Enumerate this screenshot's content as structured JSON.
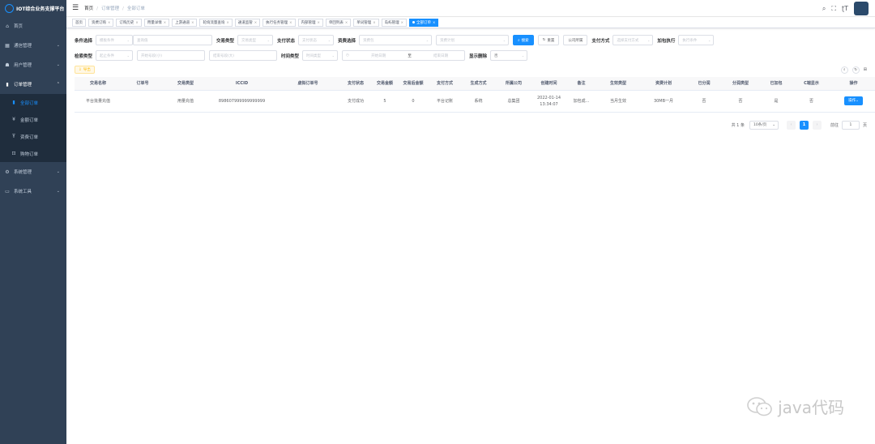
{
  "app": {
    "title": "IOT综合业务支撑平台"
  },
  "sidebar": {
    "items": [
      {
        "label": "首页",
        "icon": "home-icon"
      },
      {
        "label": "通信管理",
        "icon": "grid-icon"
      },
      {
        "label": "用户管理",
        "icon": "user-icon"
      },
      {
        "label": "订单管理",
        "icon": "chart-icon"
      },
      {
        "label": "系统管理",
        "icon": "gear-icon"
      },
      {
        "label": "系统工具",
        "icon": "tool-icon"
      }
    ],
    "order_sub": [
      {
        "label": "全部订单",
        "icon": "bar-icon"
      },
      {
        "label": "金额订单",
        "icon": "yen-icon"
      },
      {
        "label": "资费订单",
        "icon": "tariff-icon"
      },
      {
        "label": "购物订单",
        "icon": "cart-icon"
      }
    ]
  },
  "breadcrumb": {
    "home": "首页",
    "parent": "订单管理",
    "current": "全部订单"
  },
  "tags": [
    "首页",
    "资费订购",
    "订购历史",
    "用量详情",
    "上游通道",
    "轮询流量查询",
    "通道监管",
    "执行任务管理",
    "内部管理",
    "单回列表",
    "单词管理",
    "岛屿管理",
    "全部订单"
  ],
  "filters": {
    "row1": {
      "cond_label": "条件选择",
      "cond_select": "模板条件",
      "cond_input": "查询值",
      "type_label": "交易类型",
      "type_select": "交易类型",
      "pay_status_label": "支付状态",
      "pay_status_select": "支付状态",
      "tariff_label": "资费选择",
      "tariff_select": "资费包",
      "tariff_plan": "资费计划",
      "search": "搜索",
      "reset": "重置",
      "company": "公司所属",
      "pay_method_label": "支付方式",
      "pay_method_select": "选择支付方式",
      "exec_label": "加包执行",
      "exec_select": "执行条件"
    },
    "row2": {
      "search_type_label": "检索类型",
      "search_type_select": "起止条件",
      "start_no": "开始号段(小)",
      "end_no": "结束号段(大)",
      "time_type_label": "时间类型",
      "time_type_select": "时间类型",
      "start_date": "开始日期",
      "to": "至",
      "end_date": "结束日期",
      "show_delete_label": "显示删除",
      "show_delete_value": "否"
    }
  },
  "toolbar": {
    "export": "导出"
  },
  "table": {
    "headers": [
      "交易名称",
      "订单号",
      "交易类型",
      "ICCID",
      "虚拟订单号",
      "支付状态",
      "交易金额",
      "交易后金额",
      "支付方式",
      "生成方式",
      "所属公司",
      "创建时间",
      "备注",
      "生效类型",
      "资费计划",
      "已分润",
      "分润类型",
      "已加包",
      "C端显示",
      "操作"
    ],
    "rows": [
      [
        "平台批量充值",
        "",
        "用量充值",
        "898607999999999999",
        "",
        "支付成功",
        "5",
        "0",
        "平台记账",
        "系统",
        "总集团",
        "2022-01-14 13:34:07",
        "加包成...",
        "当月生效",
        "30MB一月",
        "否",
        "否",
        "是",
        "否",
        "操作"
      ]
    ]
  },
  "pager": {
    "total": "共 1 条",
    "size": "10条/页",
    "page": "1",
    "goto": "前往",
    "goto_val": "1",
    "unit": "页"
  },
  "watermark": "java代码",
  "colors": {
    "sidebar": "#304156",
    "accent": "#1890ff"
  }
}
